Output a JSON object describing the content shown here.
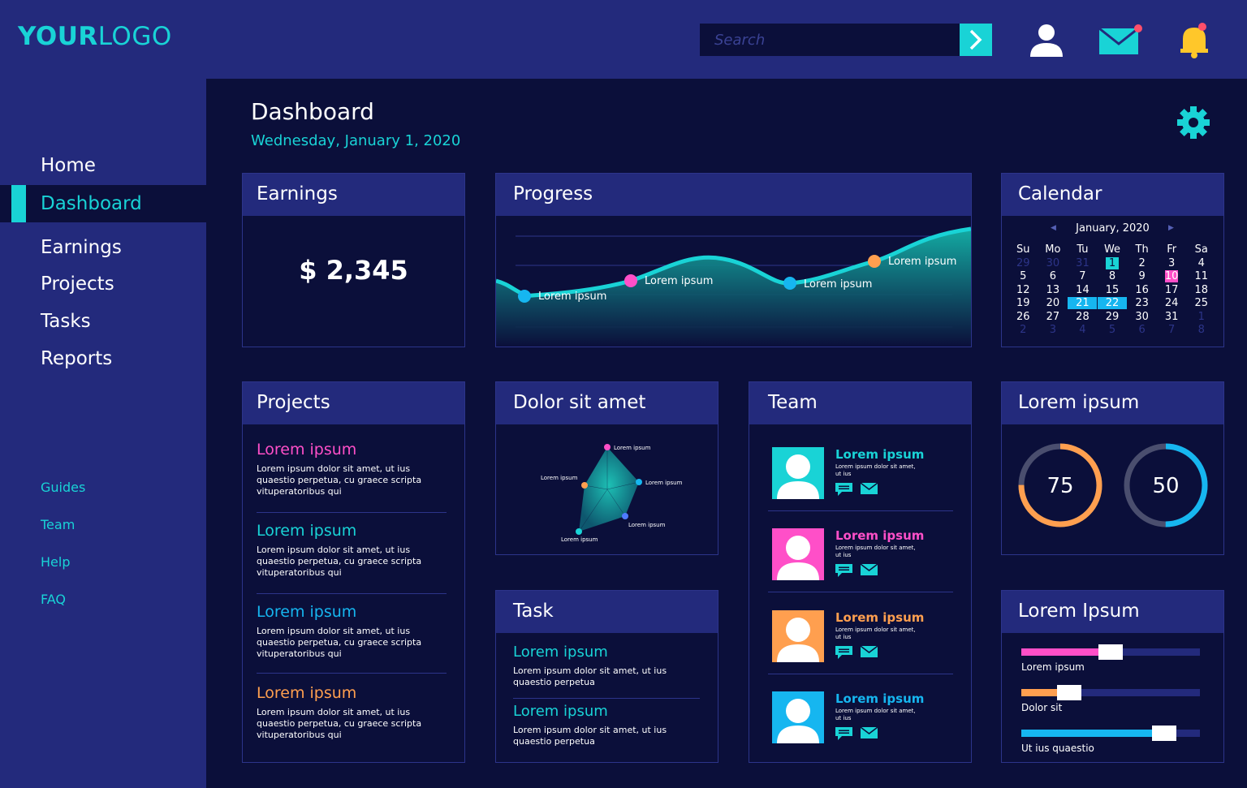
{
  "logo": {
    "bold": "YOUR",
    "light": "LOGO"
  },
  "search": {
    "placeholder": "Search"
  },
  "sidebar": {
    "items": [
      "Home",
      "Dashboard",
      "Earnings",
      "Projects",
      "Tasks",
      "Reports"
    ],
    "active": "Dashboard",
    "secondary": [
      "Guides",
      "Team",
      "Help",
      "FAQ"
    ]
  },
  "header": {
    "title": "Dashboard",
    "date": "Wednesday, January 1, 2020"
  },
  "earnings": {
    "title": "Earnings",
    "value": "$ 2,345"
  },
  "progress": {
    "title": "Progress",
    "labels": [
      "Lorem ipsum",
      "Lorem ipsum",
      "Lorem ipsum",
      "Lorem ipsum"
    ]
  },
  "calendar": {
    "title": "Calendar",
    "month": "January, 2020",
    "weekdays": [
      "Su",
      "Mo",
      "Tu",
      "We",
      "Th",
      "Fr",
      "Sa"
    ],
    "weeks": [
      [
        "29",
        "30",
        "31",
        "1",
        "2",
        "3",
        "4"
      ],
      [
        "5",
        "6",
        "7",
        "8",
        "9",
        "10",
        "11"
      ],
      [
        "12",
        "13",
        "14",
        "15",
        "16",
        "17",
        "18"
      ],
      [
        "19",
        "20",
        "21",
        "22",
        "23",
        "24",
        "25"
      ],
      [
        "26",
        "27",
        "28",
        "29",
        "30",
        "31",
        "1"
      ],
      [
        "2",
        "3",
        "4",
        "5",
        "6",
        "7",
        "8"
      ]
    ],
    "today": "1",
    "highlight_pink": "10",
    "highlight_range": [
      "21",
      "22"
    ],
    "colors": {
      "today": "#19d3d6",
      "pink": "#ff4fc8",
      "range": "#16b6f0"
    }
  },
  "projects": {
    "title": "Projects",
    "items": [
      {
        "title": "Lorem ipsum",
        "text": "Lorem ipsum dolor sit amet, ut ius quaestio perpetua, cu graece scripta vituperatoribus qui",
        "color": "#ff4fc8"
      },
      {
        "title": "Lorem ipsum",
        "text": "Lorem ipsum dolor sit amet, ut ius quaestio perpetua, cu graece scripta vituperatoribus qui",
        "color": "#19d3d6"
      },
      {
        "title": "Lorem ipsum",
        "text": "Lorem ipsum dolor sit amet, ut ius quaestio perpetua, cu graece scripta vituperatoribus qui",
        "color": "#16b6f0"
      },
      {
        "title": "Lorem ipsum",
        "text": "Lorem ipsum dolor sit amet, ut ius quaestio perpetua, cu graece scripta vituperatoribus qui",
        "color": "#ff9f4f"
      }
    ]
  },
  "dolor": {
    "title": "Dolor sit amet",
    "labels": [
      "Lorem ipsum",
      "Lorem ipsum",
      "Lorem ipsum",
      "Lorem ipsum",
      "Lorem ipsum"
    ]
  },
  "task": {
    "title": "Task",
    "items": [
      {
        "title": "Lorem ipsum",
        "text": "Lorem ipsum dolor sit amet, ut ius quaestio perpetua"
      },
      {
        "title": "Lorem ipsum",
        "text": "Lorem ipsum dolor sit amet, ut ius quaestio perpetua"
      }
    ]
  },
  "team": {
    "title": "Team",
    "members": [
      {
        "name": "Lorem ipsum",
        "desc": "Lorem ipsum dolor sit amet, ut ius",
        "color": "#19d3d6",
        "avatar_bg": "#19d3d6"
      },
      {
        "name": "Lorem ipsum",
        "desc": "Lorem ipsum dolor sit amet, ut ius",
        "color": "#ff4fc8",
        "avatar_bg": "#ff4fc8"
      },
      {
        "name": "Lorem ipsum",
        "desc": "Lorem ipsum dolor sit amet, ut ius",
        "color": "#ff9f4f",
        "avatar_bg": "#ff9f4f"
      },
      {
        "name": "Lorem ipsum",
        "desc": "Lorem ipsum dolor sit amet, ut ius",
        "color": "#16b6f0",
        "avatar_bg": "#16b6f0"
      }
    ]
  },
  "lorem_ring": {
    "title": "Lorem ipsum",
    "rings": [
      {
        "value": "75",
        "percent": 75,
        "color": "#ff9f4f"
      },
      {
        "value": "50",
        "percent": 50,
        "color": "#16b6f0"
      }
    ]
  },
  "lorem_sliders": {
    "title": "Lorem Ipsum",
    "sliders": [
      {
        "label": "Lorem ipsum",
        "percent": 50,
        "color": "#ff4fc8"
      },
      {
        "label": "Dolor sit",
        "percent": 27,
        "color": "#ff9f4f"
      },
      {
        "label": "Ut ius quaestio",
        "percent": 80,
        "color": "#16b6f0"
      }
    ]
  }
}
